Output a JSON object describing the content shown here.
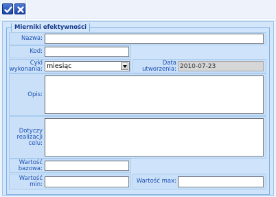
{
  "toolbar": {
    "save_icon": "checkmark-icon",
    "cancel_icon": "close-icon"
  },
  "form": {
    "legend": "Mierniki efektywności",
    "nazwa_label": "Nazwa:",
    "kod_label": "Kod:",
    "cykl_label": "Cykl wykonania:",
    "cykl_value": "miesiąc",
    "data_label": "Data utworzenia:",
    "data_value": "2010-07-23",
    "opis_label": "Opis:",
    "dotyczy_label": "Dotyczy realizacji celu:",
    "bazowa_label": "Wartość bazowa:",
    "min_label": "Wartość min:",
    "max_label": "Wartość max:"
  }
}
